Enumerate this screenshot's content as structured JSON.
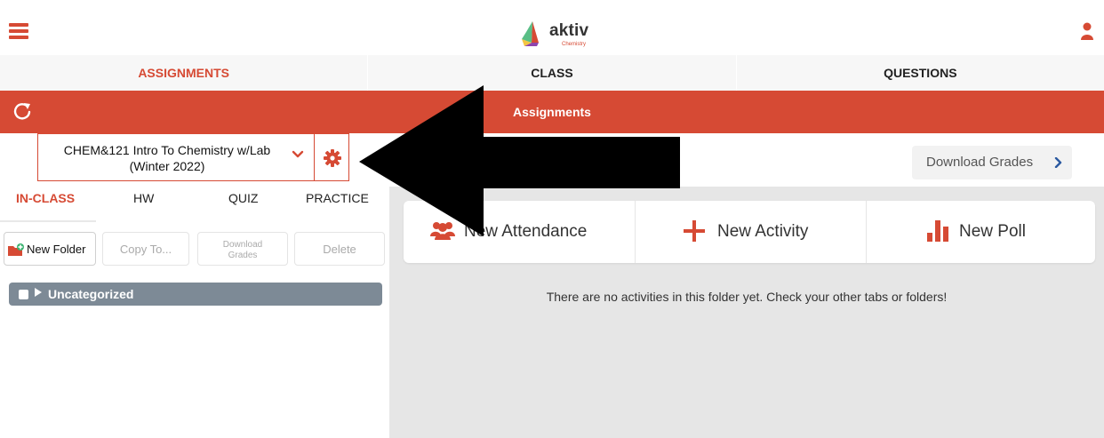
{
  "app": {
    "logo_text": "aktiv",
    "logo_subtext": "Chemistry",
    "brand_color": "#d64a34"
  },
  "main_tabs": [
    {
      "label": "ASSIGNMENTS",
      "active": true
    },
    {
      "label": "CLASS",
      "active": false
    },
    {
      "label": "QUESTIONS",
      "active": false
    }
  ],
  "header": {
    "title": "Assignments",
    "refresh_icon": "refresh-icon"
  },
  "course": {
    "line1": "CHEM&121 Intro To Chemistry w/Lab",
    "line2": "(Winter 2022)",
    "settings_icon": "gear-icon"
  },
  "sub_tabs": [
    {
      "label": "IN-CLASS",
      "active": true
    },
    {
      "label": "HW",
      "active": false
    },
    {
      "label": "QUIZ",
      "active": false
    },
    {
      "label": "PRACTICE",
      "active": false
    }
  ],
  "actions": {
    "new_folder": "New Folder",
    "copy_to": "Copy To...",
    "download_grades_line1": "Download",
    "download_grades_line2": "Grades",
    "delete": "Delete"
  },
  "folders": [
    {
      "label": "Uncategorized"
    }
  ],
  "right": {
    "download_grades": "Download Grades",
    "new_attendance": "New Attendance",
    "new_activity": "New Activity",
    "new_poll": "New Poll",
    "empty_message": "There are no activities in this folder yet. Check your other tabs or folders!"
  }
}
